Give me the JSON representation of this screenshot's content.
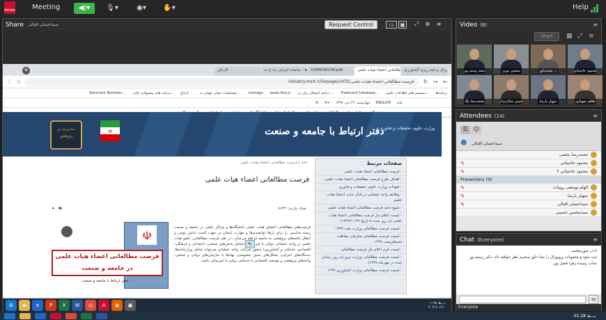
{
  "topbar": {
    "logo": "Adobe",
    "meeting_label": "Meeting",
    "help_label": "Help",
    "colors": {
      "accent": "#3cb44b",
      "bg": "#262626"
    }
  },
  "share": {
    "title": "Share",
    "presenter": "سیداحسان اقبالی",
    "request_control_label": "Request Control"
  },
  "browser": {
    "tabs": [
      "جلسه شورای برنامه ریزی گشاورزی ...",
      "فرصت مطالعاتی اعضاء هیات علمی",
      "1586616138-pdf",
      "لیست شرکت ها - سامانه اجرایی بند ج ت...",
      "کارتابل"
    ],
    "url": "industry.msrt.ir/fa/page/1435/فرصت-مطالعاتی-اعضاء-هیات-علمی",
    "bookmarks": [
      "برنامه‌ها",
      "سیستم های اطلاعات علمی...",
      "Flashcard Database...",
      "دیباچه اشتغال زنان در ...",
      "esale.ikco.ir",
      "scimago",
      "مشخصات نشان جهانی به ...",
      "ارجاع ...",
      "برنامه های پیشنهادی کتاب...",
      "Rominant Nutrition..."
    ],
    "site_top": [
      "خانه",
      "ENGLISH",
      "چهارشنبه، ۲۲ دی، ۱۳۹۹",
      "A+",
      "A-"
    ],
    "site_nav": [
      "خدمات",
      "دانشجویان",
      "کارکنان",
      "هیات علمی",
      "افراد کمیتوان",
      "دانشگاه‌ها",
      "مخترعین و صاحبان ایده",
      "کسب و کار"
    ],
    "banner_title": "دفتر ارتباط با جامعه و صنعت",
    "banner_sub": "وزارت علوم، تحقیقات و فناوری",
    "emblem_text": "مدیریت و پژوهش",
    "sidebar_title": "صفحات مرتبط",
    "sidebar_items": [
      "- فرصت مطالعاتی اعضاء هیات علمی",
      "- اهداف طرح فرصت مطالعاتی اعضاء هیات علمی",
      "- تعهدات وزارت علوم، تحقیقات و فناوری",
      "- وظایف واحد عملیاتی در قبال جذب اعضاء هیات علمی",
      "- شیوه نامه فرصت مطالعاتی اعضاء هیات علمی",
      "- لیست اعلام نیاز فرصت مطالعاتی اعضاء هیات علمی (به روز شده تا تاریخ ۱۳۹۹/۱۰/۲۲)",
      "- لیست فرصت مطالعاتی وزارت نفت ۱۳۹۹",
      "- لیست فرصت مطالعاتی سازمان حفاظت محیط‌زیست ۱۳۹۹",
      "- لیست فرم اعلام نیاز فرصت مطالعاتی",
      "- لیست فرصت مطالعاتی وزارت نیرو (به روز رسانی شده در مهرماه ۱۳۹۹)",
      "- لیست فرصت مطالعاتی وزارت کشاورزی ۱۳۹۹"
    ],
    "breadcrumb": "خانه  /  فرصت مطالعاتی اعضاء هیات علمی",
    "article_title": "فرصت مطالعاتی اعضاء هیات علمی",
    "visits": "تعداد بازدید: ۸۶۴۴",
    "article_body": "فرصت‌های مطالعاتی اعضای هیات علمی دانشگاه‌ها و مراکز علمی در جامعه و صنعت زمینه مناسبی را برای ارتقا توانمندی‌ها و مهارت ایشان در جهت کسب دانش بومی و انتقال یافته‌های پژوهشی به جامعه فراهم می‌سازد. در طی فرصت مطالعاتی، عضو هیات علمی در واحد عملیاتی دولتی یا غیردولتی (شامل بخش‌های صنعتی، اجتماعی و فرهنگی، اقتصادی، خدماتی و کشاورزی) حضور می‌یابد. واحد عملیاتی می‌تواند شامل وزارتخانه‌ها، دستگاه‌های اجرایی، تشکل‌های بخش خصوصی، نهادها یا سازمان‌های دولتی و صنعتی، واحدهای پژوهشی و توسعه، اقتصادی یا خدماتی دولتی یا غیردولتی باشد.",
    "poster_title": "فرصت مطالعاتی اعضاء هیات علمی در جامعه و صنعت",
    "poster_foot": "دفتر ارتباط با جامعه و صنعت",
    "taskbar_time": "۰۱:۲۸ ب.ظ",
    "taskbar_date": "۲۰۲۱/۰۱/۱۰"
  },
  "video": {
    "title": "Video",
    "count": "(8)",
    "start_label": "Start",
    "tiles": [
      "محمود حاجیتانی",
      "محمدیاور ...",
      "محسن نوری",
      "سعد رستم پور",
      "طاهر شهبازی",
      "سهیل پارسا",
      "جیمن شاکرنژاد",
      "محمدرضا بیگ"
    ]
  },
  "attendees": {
    "title": "Attendees",
    "count": "(14)",
    "host_name": "سیداحسان اقبالی",
    "hosts": [
      "محمدرضا بخشی",
      "محمود حاجیتانی",
      "محمود حاجیتانی ۲"
    ],
    "presenters_label": "Presenters (9)",
    "presenters": [
      "الهام یوسفی رویبات",
      "سهیل پارسا",
      "سیداحسان اقبالی",
      "سیدمحسن حسینی"
    ]
  },
  "chat": {
    "title": "Chat",
    "audience": "(Everyone)",
    "messages": [
      "تا در صورتجلسه",
      "ثبت شود و محتویات پروپوزال را بعدا دلوز محترم نظر خواهند داد. دکتر رستم پور",
      "جناب رسیده زهرا فضل پور"
    ],
    "footer_label": "Everyone"
  },
  "system": {
    "clock": "01:28 ب.ظ"
  }
}
